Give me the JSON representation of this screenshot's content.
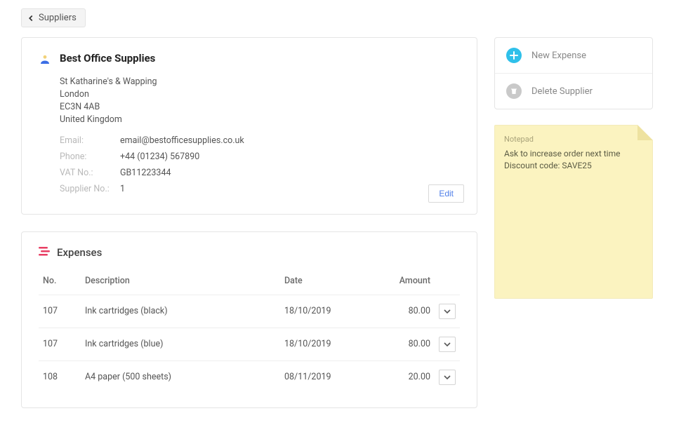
{
  "back_label": "Suppliers",
  "supplier": {
    "name": "Best Office Supplies",
    "addr1": "St Katharine's & Wapping",
    "addr2": "London",
    "addr3": "EC3N 4AB",
    "addr4": "United Kingdom"
  },
  "meta_labels": {
    "email": "Email:",
    "phone": "Phone:",
    "vat": "VAT No.:",
    "supplier_no": "Supplier No.:"
  },
  "meta": {
    "email": "email@bestofficesupplies.co.uk",
    "phone": "+44 (01234) 567890",
    "vat": "GB11223344",
    "supplier_no": "1"
  },
  "edit_label": "Edit",
  "expenses_title": "Expenses",
  "exp_headers": {
    "no": "No.",
    "desc": "Description",
    "date": "Date",
    "amount": "Amount"
  },
  "exp_rows": [
    {
      "no": "107",
      "desc": "Ink cartridges (black)",
      "date": "18/10/2019",
      "amount": "80.00"
    },
    {
      "no": "107",
      "desc": "Ink cartridges (blue)",
      "date": "18/10/2019",
      "amount": "80.00"
    },
    {
      "no": "108",
      "desc": "A4 paper (500 sheets)",
      "date": "08/11/2019",
      "amount": "20.00"
    }
  ],
  "actions": {
    "new_expense": "New Expense",
    "delete_supplier": "Delete Supplier"
  },
  "notepad": {
    "title": "Notepad",
    "text": "Ask to increase order next time\nDiscount code: SAVE25"
  }
}
